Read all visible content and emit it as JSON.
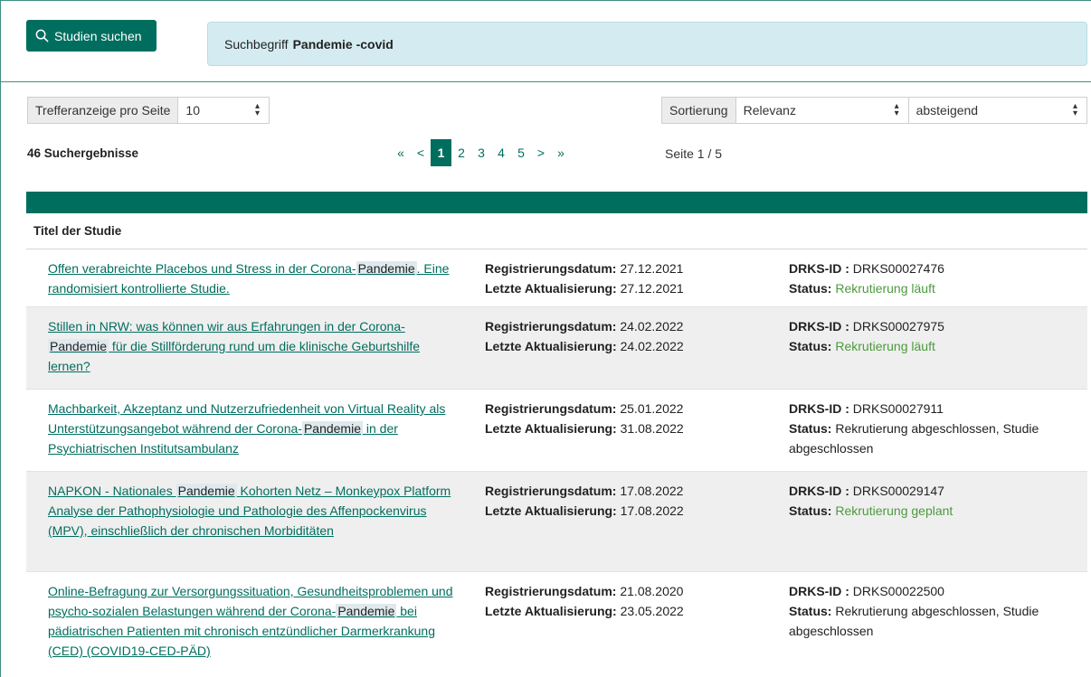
{
  "search": {
    "button_label": "Studien suchen",
    "query_label": "Suchbegriff",
    "query_value": "Pandemie -covid"
  },
  "controls": {
    "per_page_label": "Trefferanzeige pro Seite",
    "per_page_value": "10",
    "sort_label": "Sortierung",
    "sort_by": "Relevanz",
    "sort_order": "absteigend"
  },
  "results": {
    "count_text": "46 Suchergebnisse",
    "page_info": "Seite 1 / 5"
  },
  "pagination": {
    "first": "«",
    "prev": "<",
    "pages": [
      "1",
      "2",
      "3",
      "4",
      "5"
    ],
    "next": ">",
    "last": "»"
  },
  "table": {
    "column_title": "Titel der Studie",
    "reg_label": "Registrierungsdatum:",
    "upd_label": "Letzte Aktualisierung:",
    "id_label": "DRKS-ID :",
    "status_label": "Status:",
    "rows": [
      {
        "title_before": "Offen verabreichte Placebos und Stress in der Corona-",
        "highlight": "Pandemie",
        "title_after": ". Eine randomisiert kontrollierte Studie.",
        "reg_date": "27.12.2021",
        "upd_date": "27.12.2021",
        "drks_id": "DRKS00027476",
        "status": "Rekrutierung läuft",
        "status_color": "#4c9a3e"
      },
      {
        "title_before": "Stillen in NRW: was können wir aus Erfahrungen in der Corona-",
        "highlight": "Pandemie",
        "title_after": " für die Stillförderung rund um die klinische Geburtshilfe lernen?",
        "reg_date": "24.02.2022",
        "upd_date": "24.02.2022",
        "drks_id": "DRKS00027975",
        "status": "Rekrutierung läuft",
        "status_color": "#4c9a3e"
      },
      {
        "title_before": "Machbarkeit, Akzeptanz und Nutzerzufriedenheit von Virtual Reality als Unterstützungsangebot während der Corona-",
        "highlight": "Pandemie",
        "title_after": " in der Psychiatrischen Institutsambulanz",
        "reg_date": "25.01.2022",
        "upd_date": "31.08.2022",
        "drks_id": "DRKS00027911",
        "status": "Rekrutierung abgeschlossen, Studie abgeschlossen",
        "status_color": "#222222"
      },
      {
        "title_before": "NAPKON - Nationales ",
        "highlight": "Pandemie",
        "title_after": " Kohorten Netz – Monkeypox Platform Analyse der Pathophysiologie und Pathologie des Affenpockenvirus (MPV), einschließlich der chronischen Morbiditäten",
        "reg_date": "17.08.2022",
        "upd_date": "17.08.2022",
        "drks_id": "DRKS00029147",
        "status": "Rekrutierung geplant",
        "status_color": "#4c9a3e"
      },
      {
        "title_before": "Online-Befragung zur Versorgungssituation, Gesundheitsproblemen und psycho-sozialen Belastungen während der Corona-",
        "highlight": "Pandemie",
        "title_after": " bei pädiatrischen Patienten mit chronisch entzündlicher Darmerkrankung (CED) (COVID19-CED-PÄD)",
        "reg_date": "21.08.2020",
        "upd_date": "23.05.2022",
        "drks_id": "DRKS00022500",
        "status": "Rekrutierung abgeschlossen, Studie abgeschlossen",
        "status_color": "#222222"
      }
    ]
  }
}
